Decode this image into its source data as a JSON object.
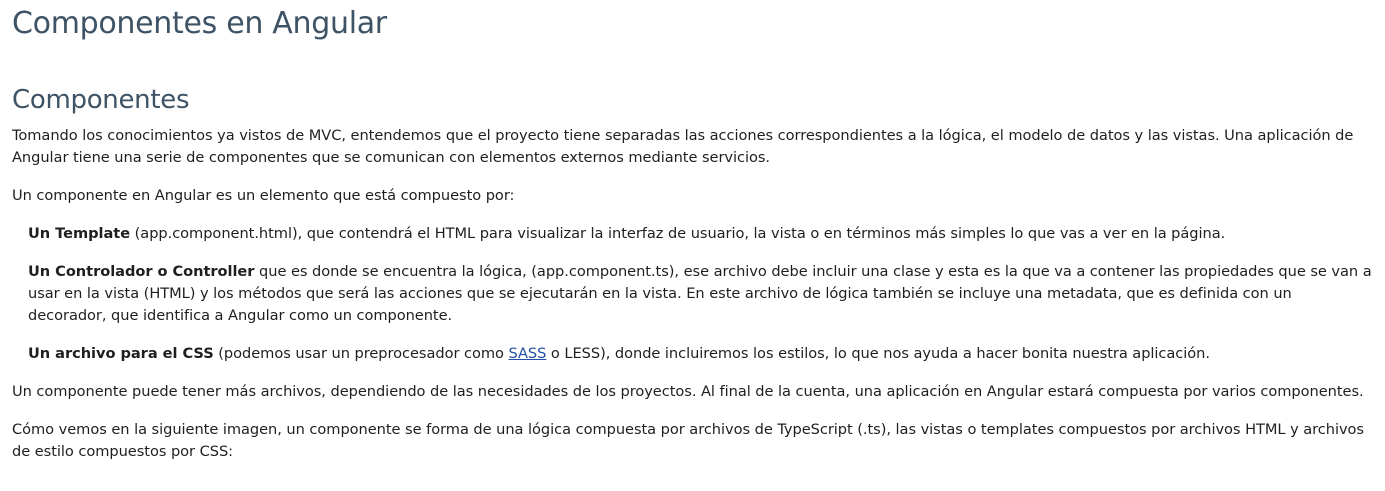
{
  "title": "Componentes en Angular",
  "section": {
    "heading": "Componentes",
    "intro": "Tomando los conocimientos ya vistos de MVC, entendemos que el proyecto tiene separadas las acciones correspondientes a la lógica, el modelo de datos y las vistas. Una aplicación de Angular tiene una serie de componentes que se comunican con elementos externos mediante servicios.",
    "lead": "Un componente en Angular es un elemento que está compuesto por:",
    "item_template": {
      "bold": "Un Template",
      "text": " (app.component.html), que contendrá el HTML para visualizar la interfaz de usuario, la vista o en términos más simples lo que vas a ver en la página."
    },
    "item_controller": {
      "bold": "Un Controlador o Controller",
      "text": " que es donde se encuentra la lógica, (app.component.ts), ese archivo debe incluir una clase y esta es la que va a contener las propiedades que se van a usar en la vista (HTML) y los métodos que será las acciones que se ejecutarán en la vista. En este archivo de lógica también se incluye una metadata, que es definida con un decorador, que identifica a Angular como un componente."
    },
    "item_css": {
      "bold": "Un archivo para el CSS",
      "text_before": " (podemos usar un preprocesador como ",
      "link": "SASS",
      "text_after": " o LESS), donde incluiremos los estilos, lo que nos ayuda a hacer bonita nuestra aplicación."
    },
    "more_files": "Un componente puede tener más archivos, dependiendo de las necesidades de los proyectos. Al final de la cuenta, una aplicación en Angular estará compuesta por varios componentes.",
    "image_intro": "Cómo vemos en la siguiente imagen, un componente se forma de una lógica compuesta por archivos de TypeScript (.ts), las vistas o templates compuestos por archivos HTML y archivos de estilo compuestos por CSS:"
  }
}
